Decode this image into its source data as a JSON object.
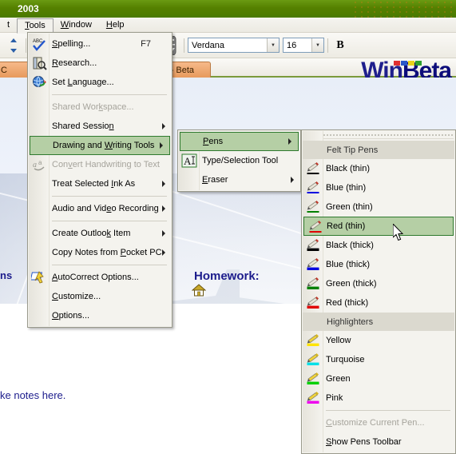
{
  "window": {
    "title": "2003"
  },
  "menubar": {
    "items": [
      {
        "label": "t",
        "underline": "",
        "active": false
      },
      {
        "label": "Tools",
        "underline": "T",
        "active": true
      },
      {
        "label": "Window",
        "underline": "W",
        "active": false
      },
      {
        "label": "Help",
        "underline": "H",
        "active": false
      }
    ]
  },
  "toolbar": {
    "pen_icon": "pen-icon",
    "eraser_icon": "eraser-icon",
    "type_selection_icon": "type-selection-tool-icon",
    "delete_icon": "delete-x-icon",
    "scroll_icon": "scroll-handle-icon",
    "font_name": "Verdana",
    "font_size": "16",
    "bold_label": "B"
  },
  "tabs": [
    {
      "label": "C"
    },
    {
      "label": "ps - Beta"
    }
  ],
  "logo": {
    "text_win": "Win",
    "text_beta": "Beta",
    "block_colors": [
      "#e03030",
      "#2a57c8",
      "#e8d21a",
      "#2fa02f"
    ]
  },
  "canvas": {
    "note_title": "Homework:",
    "home_icon": "home-icon",
    "notes_text": "ke notes here.",
    "left_fragment": "ns"
  },
  "tools_menu": {
    "name": "Tools",
    "items": [
      {
        "label": "Spelling...",
        "underline": "S",
        "accel": "F7",
        "icon": "spelling-check-icon",
        "disabled": false,
        "submenu": false,
        "selected": false
      },
      {
        "label": "Research...",
        "underline": "R",
        "accel": "",
        "icon": "research-book-icon",
        "disabled": false,
        "submenu": false,
        "selected": false
      },
      {
        "label": "Set Language...",
        "underline": "L",
        "accel": "",
        "icon": "set-language-globe-icon",
        "disabled": false,
        "submenu": false,
        "selected": false
      },
      {
        "separator": true
      },
      {
        "label": "Shared Workspace...",
        "underline": "k",
        "accel": "",
        "icon": "",
        "disabled": true,
        "submenu": false,
        "selected": false
      },
      {
        "label": "Shared Session",
        "underline": "n",
        "accel": "",
        "icon": "",
        "disabled": false,
        "submenu": true,
        "selected": false
      },
      {
        "label": "Drawing and Writing Tools",
        "underline": "W",
        "accel": "",
        "icon": "",
        "disabled": false,
        "submenu": true,
        "selected": true
      },
      {
        "label": "Convert Handwriting to Text",
        "underline": "v",
        "accel": "",
        "icon": "convert-handwriting-icon",
        "disabled": true,
        "submenu": false,
        "selected": false
      },
      {
        "label": "Treat Selected Ink As",
        "underline": "I",
        "accel": "",
        "icon": "",
        "disabled": false,
        "submenu": true,
        "selected": false
      },
      {
        "separator": true
      },
      {
        "label": "Audio and Video Recording",
        "underline": "e",
        "accel": "",
        "icon": "",
        "disabled": false,
        "submenu": true,
        "selected": false
      },
      {
        "separator": true
      },
      {
        "label": "Create Outlook Item",
        "underline": "k",
        "accel": "",
        "icon": "",
        "disabled": false,
        "submenu": true,
        "selected": false
      },
      {
        "label": "Copy Notes from Pocket PC",
        "underline": "P",
        "accel": "",
        "icon": "",
        "disabled": false,
        "submenu": true,
        "selected": false
      },
      {
        "separator": true
      },
      {
        "label": "AutoCorrect Options...",
        "underline": "A",
        "accel": "",
        "icon": "autocorrect-icon",
        "disabled": false,
        "submenu": false,
        "selected": false
      },
      {
        "label": "Customize...",
        "underline": "C",
        "accel": "",
        "icon": "",
        "disabled": false,
        "submenu": false,
        "selected": false
      },
      {
        "label": "Options...",
        "underline": "O",
        "accel": "",
        "icon": "",
        "disabled": false,
        "submenu": false,
        "selected": false
      }
    ]
  },
  "drawing_menu": {
    "name": "Drawing and Writing Tools",
    "items": [
      {
        "label": "Pens",
        "underline": "P",
        "icon": "",
        "submenu": true,
        "selected": true
      },
      {
        "label": "Type/Selection Tool",
        "underline": "",
        "icon": "type-selection-tool-icon",
        "submenu": false,
        "selected": false
      },
      {
        "label": "Eraser",
        "underline": "E",
        "icon": "",
        "submenu": true,
        "selected": false
      }
    ]
  },
  "pens_menu": {
    "name": "Pens",
    "grip": "drag-grip-handle",
    "groups": [
      {
        "header": "Felt Tip Pens",
        "items": [
          {
            "label": "Black (thin)",
            "color": "#000000",
            "thick": false,
            "selected": false
          },
          {
            "label": "Blue (thin)",
            "color": "#0000e0",
            "thick": false,
            "selected": false
          },
          {
            "label": "Green (thin)",
            "color": "#008000",
            "thick": false,
            "selected": false
          },
          {
            "label": "Red (thin)",
            "color": "#e00000",
            "thick": false,
            "selected": true
          },
          {
            "label": "Black (thick)",
            "color": "#000000",
            "thick": true,
            "selected": false
          },
          {
            "label": "Blue (thick)",
            "color": "#0000e0",
            "thick": true,
            "selected": false
          },
          {
            "label": "Green (thick)",
            "color": "#008000",
            "thick": true,
            "selected": false
          },
          {
            "label": "Red (thick)",
            "color": "#e00000",
            "thick": true,
            "selected": false
          }
        ]
      },
      {
        "header": "Highlighters",
        "items": [
          {
            "label": "Yellow",
            "color": "#ffe400",
            "thick": true,
            "selected": false,
            "highlighter": true
          },
          {
            "label": "Turquoise",
            "color": "#00e0e8",
            "thick": true,
            "selected": false,
            "highlighter": true
          },
          {
            "label": "Green",
            "color": "#00d000",
            "thick": true,
            "selected": false,
            "highlighter": true
          },
          {
            "label": "Pink",
            "color": "#ee00ee",
            "thick": true,
            "selected": false,
            "highlighter": true
          }
        ]
      }
    ],
    "footer": [
      {
        "label": "Customize Current Pen...",
        "underline": "C",
        "disabled": true
      },
      {
        "label": "Show Pens Toolbar",
        "underline": "S",
        "disabled": false
      }
    ]
  }
}
